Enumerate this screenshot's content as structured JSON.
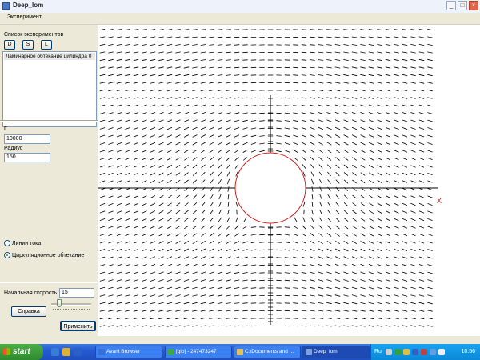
{
  "window": {
    "title": "Deep_lom",
    "minimize_glyph": "_",
    "maximize_glyph": "□",
    "close_glyph": "×"
  },
  "menu": {
    "items": [
      "Эксперимент"
    ]
  },
  "experiments": {
    "header": "Список экспериментов",
    "buttons": [
      "D",
      "S",
      "L"
    ],
    "list": [
      "Ламинарное обтекание цилиндра 0"
    ]
  },
  "params": {
    "gamma_label": "Г",
    "gamma_value": "10000",
    "radius_label": "Радиус",
    "radius_value": "150"
  },
  "mode": {
    "options": [
      "Линии тока",
      "Циркуляционное обтекание"
    ],
    "selected_index": 1
  },
  "velocity": {
    "label": "Начальная скорость",
    "value": "15",
    "slider_fraction": 0.15
  },
  "actions": {
    "help_label": "Справка",
    "apply_label": "Применить"
  },
  "plot": {
    "axis_label_x": "X",
    "circle_color": "#cc2222",
    "vector_color": "#000000",
    "axis_color": "#000000"
  },
  "taskbar": {
    "start_label": "start",
    "tasks": [
      {
        "label": "Avant Browser",
        "icon_color": "#3a6fd8"
      },
      {
        "label": "[qip] - 247473247",
        "icon_color": "#3aa844"
      },
      {
        "label": "C:\\Documents and ...",
        "icon_color": "#e8c060"
      },
      {
        "label": "Deep_lom",
        "icon_color": "#7da0e0"
      }
    ],
    "tray_lang": "Ru",
    "clock": "10:56"
  }
}
